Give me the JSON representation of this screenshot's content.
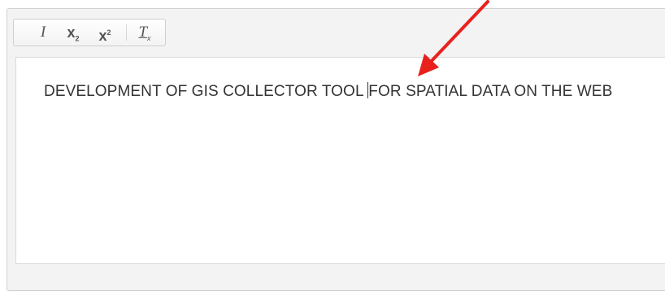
{
  "toolbar": {
    "buttons": [
      {
        "name": "italic",
        "glyph": "I"
      },
      {
        "name": "subscript",
        "glyph": "x",
        "script": "2"
      },
      {
        "name": "superscript",
        "glyph": "x",
        "script": "2"
      },
      {
        "name": "remove-format",
        "glyph": "T",
        "script": "x"
      }
    ]
  },
  "editor": {
    "text_before_caret": "DEVELOPMENT OF GIS COLLECTOR TOOL ",
    "text_after_caret": "FOR SPATIAL DATA ON THE WEB"
  },
  "colors": {
    "arrow": "#e8211c",
    "text": "#333333",
    "chrome": "#f3f3f3",
    "border": "#d1d1d1"
  },
  "icons": [
    "italic-icon",
    "subscript-icon",
    "superscript-icon",
    "remove-format-icon",
    "red-arrow-annotation",
    "resize-grip-icon"
  ]
}
